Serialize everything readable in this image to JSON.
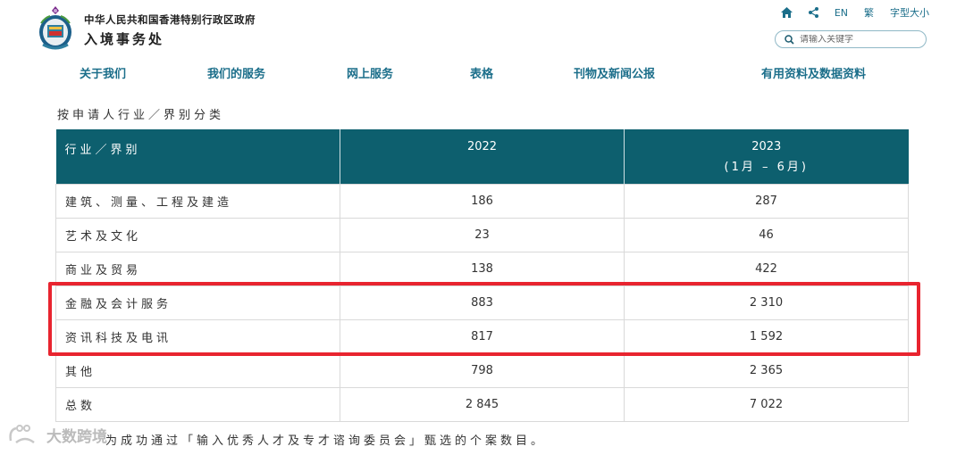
{
  "header": {
    "gov_title": "中华人民共和国香港特别行政区政府",
    "dept_title": "入境事务处",
    "utilities": {
      "lang_en": "EN",
      "lang_trad": "繁",
      "font_size": "字型大小"
    },
    "search": {
      "placeholder": "请输入关键字"
    }
  },
  "nav": {
    "items": [
      "关于我们",
      "我们的服务",
      "网上服务",
      "表格",
      "刊物及新闻公报",
      "有用资料及数据资料"
    ]
  },
  "table": {
    "caption": "按申请人行业／界别分类",
    "headers": {
      "sector": "行业／界别",
      "col_2022": "2022",
      "col_2023": "2023",
      "col_2023_sub": "(1月 – 6月)"
    },
    "rows": [
      {
        "sector": "建筑、测量、工程及建造",
        "y2022": "186",
        "y2023": "287"
      },
      {
        "sector": "艺术及文化",
        "y2022": "23",
        "y2023": "46"
      },
      {
        "sector": "商业及贸易",
        "y2022": "138",
        "y2023": "422"
      },
      {
        "sector": "金融及会计服务",
        "y2022": "883",
        "y2023": "2 310"
      },
      {
        "sector": "资讯科技及电讯",
        "y2022": "817",
        "y2023": "1 592"
      },
      {
        "sector": "其他",
        "y2022": "798",
        "y2023": "2 365"
      },
      {
        "sector": "总数",
        "y2022": "2 845",
        "y2023": "7 022"
      }
    ],
    "highlighted_rows": [
      "金融及会计服务",
      "资讯科技及电讯"
    ]
  },
  "footnote": "为成功通过「输入优秀人才及专才谘询委员会」甄选的个案数目。",
  "watermark": "大数跨境",
  "colors": {
    "header_bg": "#0d5f6e",
    "accent": "#1b6e8a",
    "highlight": "#e8242f"
  },
  "icons": [
    "emblem-logo",
    "home-icon",
    "share-icon",
    "search-icon"
  ]
}
